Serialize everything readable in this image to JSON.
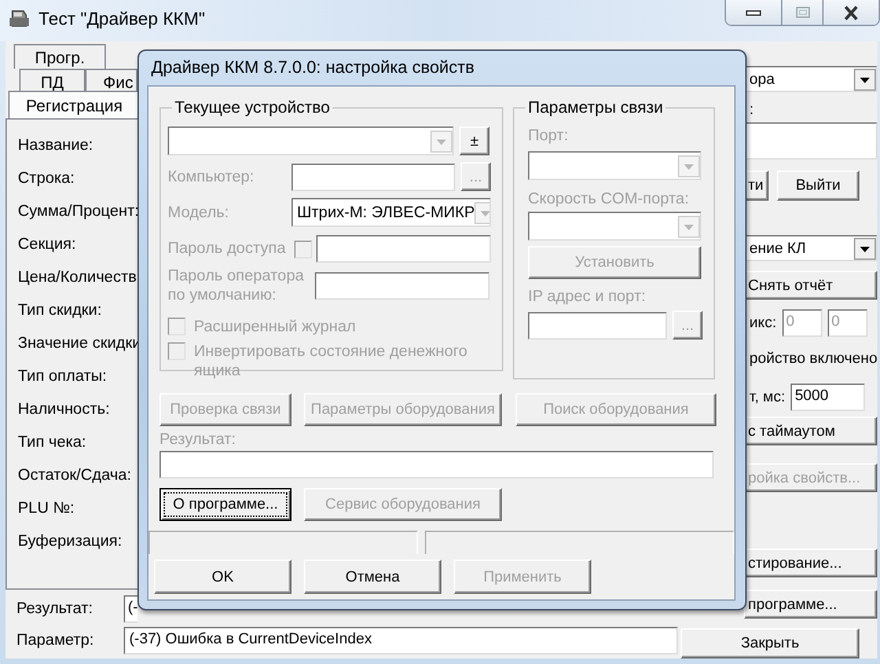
{
  "window": {
    "title": "Тест \"Драйвер ККМ\""
  },
  "tabs_row_1": [
    {
      "label": "Прогр.",
      "selected": false
    }
  ],
  "tabs_row_2": [
    {
      "label": "ПД",
      "selected": false
    },
    {
      "label": "Фис",
      "selected": false
    }
  ],
  "page_tab": {
    "label": "Регистрация",
    "selected": true
  },
  "field_labels": [
    "Название:",
    "Строка:",
    "Сумма/Процент:",
    "Секция:",
    "Цена/Количеств",
    "Тип скидки:",
    "Значение скидки",
    "Тип оплаты:",
    "Наличность:",
    "Тип чека:",
    "Остаток/Сдача:",
    "PLU №:",
    "Буферизация:"
  ],
  "right_panel": [
    {
      "kind": "combo",
      "value": "ора"
    },
    {
      "kind": "label",
      "text": ":"
    },
    {
      "kind": "input"
    },
    {
      "kind": "button_pair",
      "labels": [
        "ти",
        "Выйти"
      ]
    },
    {
      "kind": "combo",
      "value": "ение КЛ"
    },
    {
      "kind": "button",
      "label": "Снять отчёт",
      "disabled": false
    },
    {
      "kind": "label_inputs",
      "text": "икс:",
      "values": [
        "0",
        "0"
      ],
      "disabled": true
    },
    {
      "kind": "label",
      "text": "ройство включено"
    },
    {
      "kind": "label_inputs",
      "text": "т, мс:",
      "values": [
        "5000"
      ],
      "disabled": false
    },
    {
      "kind": "button",
      "label": "с таймаутом",
      "disabled": false
    },
    {
      "kind": "button",
      "label": "ройка свойств...",
      "disabled": true
    },
    {
      "kind": "button",
      "label": "стирование...",
      "disabled": false
    },
    {
      "kind": "button",
      "label": "программе...",
      "disabled": false
    }
  ],
  "close_button": "Закрыть",
  "bottom_fields": [
    {
      "label": "Результат:",
      "value": "(-"
    },
    {
      "label": "Параметр:",
      "value": "(-37) Ошибка в CurrentDeviceIndex"
    }
  ],
  "dialog": {
    "title": "Драйвер ККМ 8.7.0.0: настройка свойств",
    "current_device": {
      "title": "Текущее устройство",
      "device_combo": {
        "disabled": true
      },
      "add_remove_button": "±",
      "computer": {
        "label": "Компьютер:",
        "browse": "..."
      },
      "model": {
        "label": "Модель:",
        "value": "Штрих-М: ЭЛВЕС-МИКР",
        "disabled": true
      },
      "access_password": {
        "label": "Пароль доступа",
        "checked": false
      },
      "operator_password": {
        "label": "Пароль оператора по умолчанию:"
      },
      "options": [
        {
          "label": "Расширенный журнал",
          "checked": false
        },
        {
          "label": "Инвертировать состояние денежного ящика",
          "checked": false
        }
      ]
    },
    "connection": {
      "title": "Параметры связи",
      "port_label": "Порт:",
      "speed_label": "Скорость COM-порта:",
      "set_button": "Установить",
      "ip_label": "IP адрес и порт:",
      "browse": "..."
    },
    "actions": [
      {
        "label": "Проверка связи",
        "disabled": true
      },
      {
        "label": "Параметры оборудования",
        "disabled": true
      },
      {
        "label": "Поиск оборудования",
        "disabled": true
      }
    ],
    "result_label": "Результат:",
    "extra_buttons": [
      {
        "label": "О программе...",
        "disabled": false,
        "focused": true
      },
      {
        "label": "Сервис оборудования",
        "disabled": true,
        "focused": false
      }
    ],
    "buttons": [
      {
        "label": "OK",
        "disabled": false
      },
      {
        "label": "Отмена",
        "disabled": false
      },
      {
        "label": "Применить",
        "disabled": true
      }
    ]
  }
}
